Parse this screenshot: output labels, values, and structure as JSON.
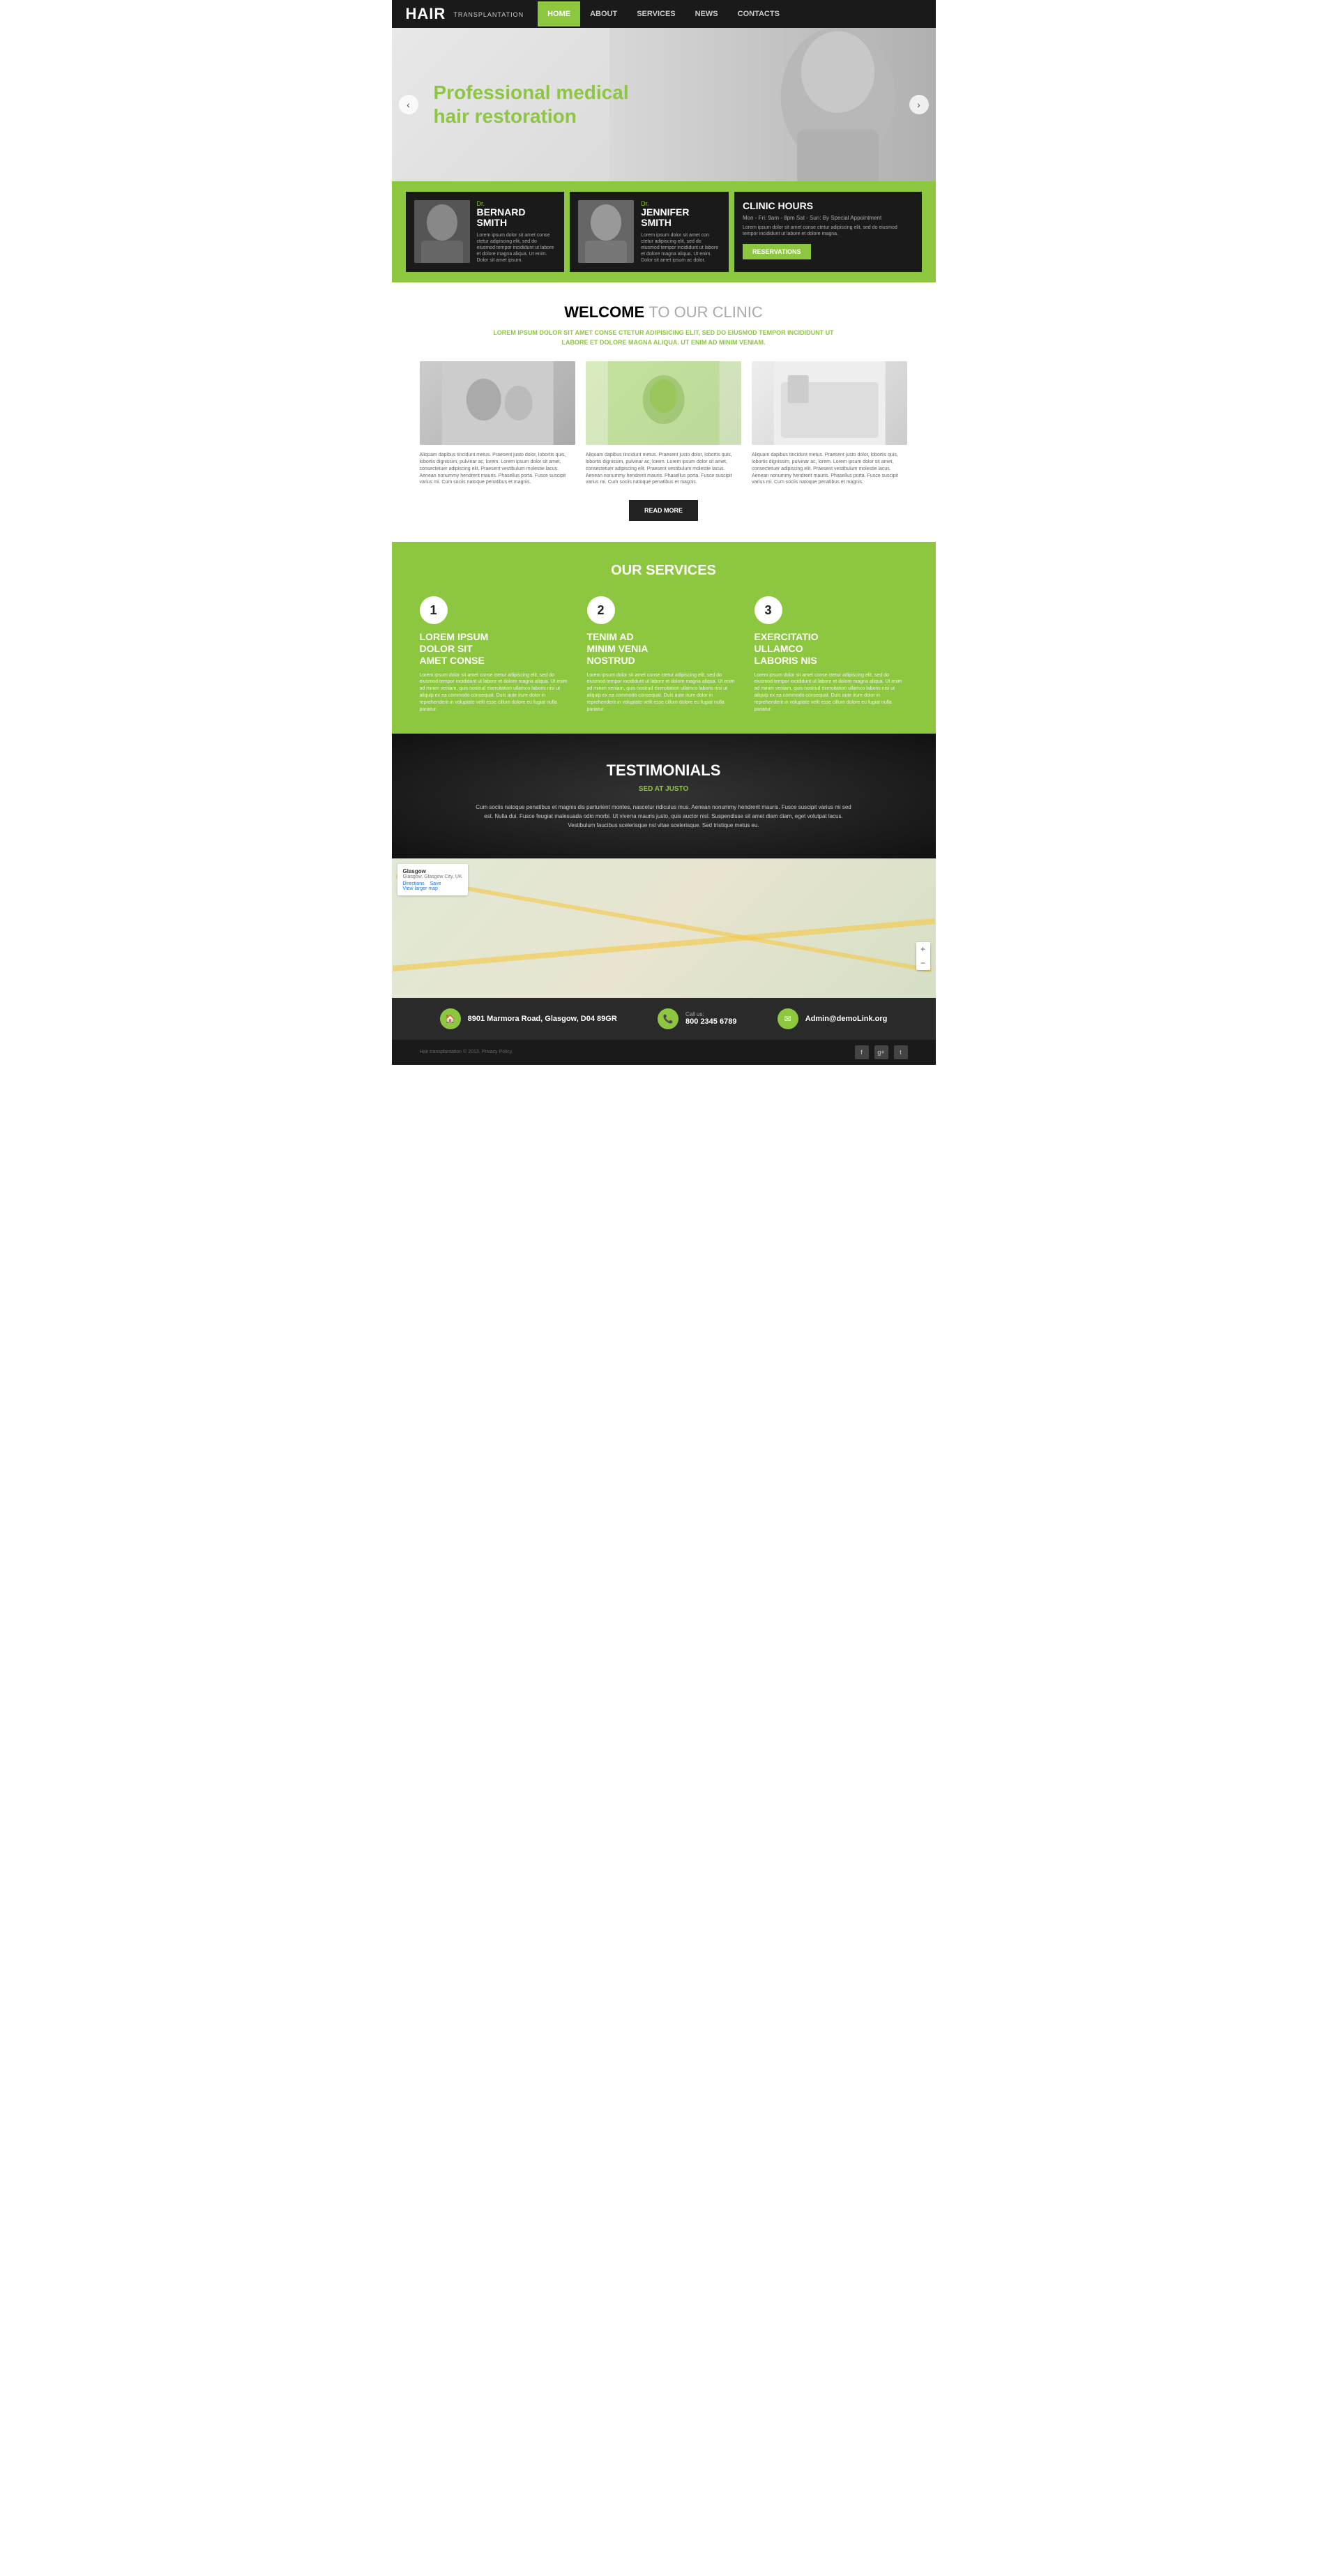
{
  "nav": {
    "logo": "Hair",
    "logo_sub": "TRANSPLANTATION",
    "items": [
      {
        "label": "HOME",
        "active": true
      },
      {
        "label": "ABOUT",
        "active": false
      },
      {
        "label": "SERVICES",
        "active": false
      },
      {
        "label": "NEWS",
        "active": false
      },
      {
        "label": "CONTACTS",
        "active": false
      }
    ]
  },
  "hero": {
    "title_line1": "Professional medical",
    "title_line2": "hair restoration",
    "prev_arrow": "‹",
    "next_arrow": "›"
  },
  "doctors": [
    {
      "title": "Dr.",
      "name_line1": "BERNARD",
      "name_line2": "SMITH",
      "desc": "Lorem ipsum dolor sit amet conse ctetur adipiscing elit, sed do eiusmod tempor incididunt ut labore et dolore magna aliqua. Ut enim. Dolor sit amet ipsum."
    },
    {
      "title": "Dr.",
      "name_line1": "JENNIFER",
      "name_line2": "SMITH",
      "desc": "Lorem ipsum dolor sit amet con ctetur adipiscing elit, sed do eiusmod tempor incididunt ut labore et dolore magna aliqua. Ut enim. Dolor sit amet ipsum ac dolor."
    }
  ],
  "clinic": {
    "title": "CLINIC HOURS",
    "hours": "Mon - Fri: 9am - 8pm Sat - Sun: By Special Appointment",
    "desc": "Lorem ipsum dolor sit amet conse ctetur adipiscing elit, sed do eiusmod tempor incididunt ut labore et dolore magna.",
    "button": "RESERVATIONS"
  },
  "welcome": {
    "title_bold": "WELCOME",
    "title_light": "TO OUR CLINIC",
    "subtitle": "LOREM IPSUM DOLOR SIT AMET CONSE CTETUR ADIPISICING ELIT, SED DO EIUSMOD TEMPOR INCIDIDUNT UT\nLABORE ET DOLORE MAGNA ALIQUA. UT ENIM AD MINIM VENIAM.",
    "cards": [
      {
        "text": "Aliquam dapibus tincidunt metus. Praesent justo dolor, lobortis quis, lobortis dignissim, pulvinar ac, lorem. Lorem ipsum dolor sit amet, consectetuer adipiscing elit. Praesent vestibulum molestie lacus. Aenean nonummy hendrerit mauris. Phasellus porta. Fusce suscipit varius mi. Cum sociis natoque penatibus et magnis."
      },
      {
        "text": "Aliquam dapibus tincidunt metus. Praesent justo dolor, lobortis quis, lobortis dignissim, pulvinar ac, lorem. Lorem ipsum dolor sit amet, consectetuer adipiscing elit. Praesent vestibulum molestie lacus. Aenean nonummy hendrerit mauris. Phasellus porta. Fusce suscipit varius mi. Cum sociis natoque penatibus et magnis."
      },
      {
        "text": "Aliquam dapibus tincidunt metus. Praesent justo dolor, lobortis quis, lobortis dignissim, pulvinar ac, lorem. Lorem ipsum dolor sit amet, consectetuer adipiscing elit. Praesent vestibulum molestie lacus. Aenean nonummy hendrerit mauris. Phasellus porta. Fusce suscipit varius mi. Cum sociis natoque penatibus et magnis."
      }
    ],
    "read_more": "READ MORE"
  },
  "services": {
    "title_light": "OUR ",
    "title_bold": "SERVICES",
    "items": [
      {
        "number": "1",
        "name": "LOREM IPSUM\nDOLOR SIT\nAMET CONSE",
        "desc": "Lorem ipsum dolor sit amet conse ctetur adipiscing elit, sed do eiusmod tempor incididunt ut labore et dolore magna aliqua. Ut enim ad minim veniam, quis nostrud exercitation ullamco laboris nisi ut aliquip ex ea commodo consequat. Duis aute irure dolor in reprehenderit in voluptate velit esse cillum dolore eu fugiat nulla pariatur."
      },
      {
        "number": "2",
        "name": "TENIM AD\nMINIM VENIA\nNOSTRUD",
        "desc": "Lorem ipsum dolor sit amet conse ctetur adipiscing elit, sed do eiusmod tempor incididunt ut labore et dolore magna aliqua. Ut enim ad minim veniam, quis nostrud exercitation ullamco laboris nisi ut aliquip ex ea commodo consequat. Duis aute irure dolor in reprehenderit in voluptate velit esse cillum dolore eu fugiat nulla pariatur."
      },
      {
        "number": "3",
        "name": "EXERCITATIO\nULLAMCO\nLABORIS NIS",
        "desc": "Lorem ipsum dolor sit amet conse ctetur adipiscing elit, sed do eiusmod tempor incididunt ut labore et dolore magna aliqua. Ut enim ad minim veniam, quis nostrud exercitation ullamco laboris nisi ut aliquip ex ea commodo consequat. Duis aute irure dolor in reprehenderit in voluptate velit esse cillum dolore eu fugiat nulla pariatur."
      }
    ]
  },
  "testimonials": {
    "title": "TESTIMONIALS",
    "subtitle": "SED AT JUSTO",
    "text": "Cum sociis natoque penatibus et magnis dis parturient montes, nascetur ridiculus mus. Aenean nonummy hendrerit mauris. Fusce suscipit varius mi sed est. Nulla dui. Fusce feugiat malesuada odio morbi. Ut viverra mauris justo, quis auctor nisl. Suspendisse sit amet diam diam, eget volutpat lacus. Vestibulum faucibus scelerisque nsl vitae scelerisque. Sed tristique metus eu."
  },
  "map": {
    "city": "Glasgow",
    "country": "Glasgow, Glasgow City, UK",
    "directions_label": "Directions",
    "save_label": "Save",
    "larger_map_label": "View larger map"
  },
  "footer_info": {
    "address_icon": "🏠",
    "address": "8901 Marmora Road, Glasgow, D04 89GR",
    "phone_icon": "📞",
    "call_us": "Call us:",
    "phone": "800 2345 6789",
    "email_icon": "✉",
    "email": "Admin@demoLink.org"
  },
  "footer_bottom": {
    "copyright": "Hair transplantation © 2013. Privacy Policy.",
    "social": [
      "f",
      "g+",
      "t"
    ]
  }
}
